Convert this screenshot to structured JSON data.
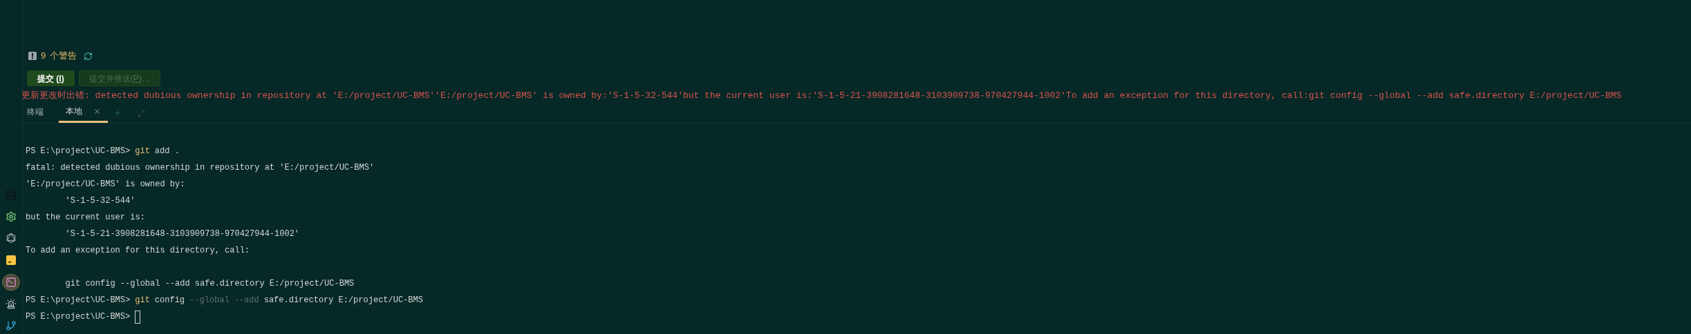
{
  "sidebar": {
    "items": [
      {
        "selected": false
      },
      {
        "selected": false
      },
      {
        "selected": false
      },
      {
        "selected": false
      },
      {
        "selected": true
      },
      {
        "selected": false
      },
      {
        "selected": false
      }
    ]
  },
  "warnings": {
    "count": "9",
    "label": "个警告"
  },
  "buttons": [
    {
      "before": "提交 (",
      "mnemonic": "I",
      "after": ")",
      "disabled": false
    },
    {
      "before": "提交并推送(",
      "mnemonic": "P",
      "after": ")…",
      "disabled": true
    }
  ],
  "error_message": "更新更改时出错: detected dubious ownership in repository at 'E:/project/UC-BMS''E:/project/UC-BMS' is owned by:'S-1-5-32-544'but the current user is:'S-1-5-21-3908281648-3103909738-970427944-1002'To add an exception for this directory, call:git config --global --add safe.directory E:/project/UC-BMS",
  "panel_title": "终端",
  "tabs": [
    {
      "label": "本地",
      "selected": true
    }
  ],
  "terminal": {
    "lines": [
      {
        "kind": "prompt",
        "prompt": "PS E:\\project\\UC-BMS>",
        "tokens": [
          {
            "kind": "command",
            "text": "git"
          },
          {
            "kind": "arg",
            "text": "add ."
          }
        ],
        "cursor": false
      },
      {
        "kind": "output",
        "text": "fatal: detected dubious ownership in repository at 'E:/project/UC-BMS'"
      },
      {
        "kind": "output",
        "text": "'E:/project/UC-BMS' is owned by:"
      },
      {
        "kind": "output",
        "text": "        'S-1-5-32-544'"
      },
      {
        "kind": "output",
        "text": "but the current user is:"
      },
      {
        "kind": "output",
        "text": "        'S-1-5-21-3908281648-3103909738-970427944-1002'"
      },
      {
        "kind": "output",
        "text": "To add an exception for this directory, call:"
      },
      {
        "kind": "blank"
      },
      {
        "kind": "output",
        "text": "        git config --global --add safe.directory E:/project/UC-BMS"
      },
      {
        "kind": "prompt",
        "prompt": "PS E:\\project\\UC-BMS>",
        "tokens": [
          {
            "kind": "command",
            "text": "git"
          },
          {
            "kind": "arg",
            "text": "config"
          },
          {
            "kind": "flag",
            "text": "--global"
          },
          {
            "kind": "flag",
            "text": "--add"
          },
          {
            "kind": "arg",
            "text": "safe.directory"
          },
          {
            "kind": "arg",
            "text": "E:/project/UC-BMS"
          }
        ],
        "cursor": false
      },
      {
        "kind": "prompt",
        "prompt": "PS E:\\project\\UC-BMS>",
        "cursor": true
      }
    ]
  }
}
